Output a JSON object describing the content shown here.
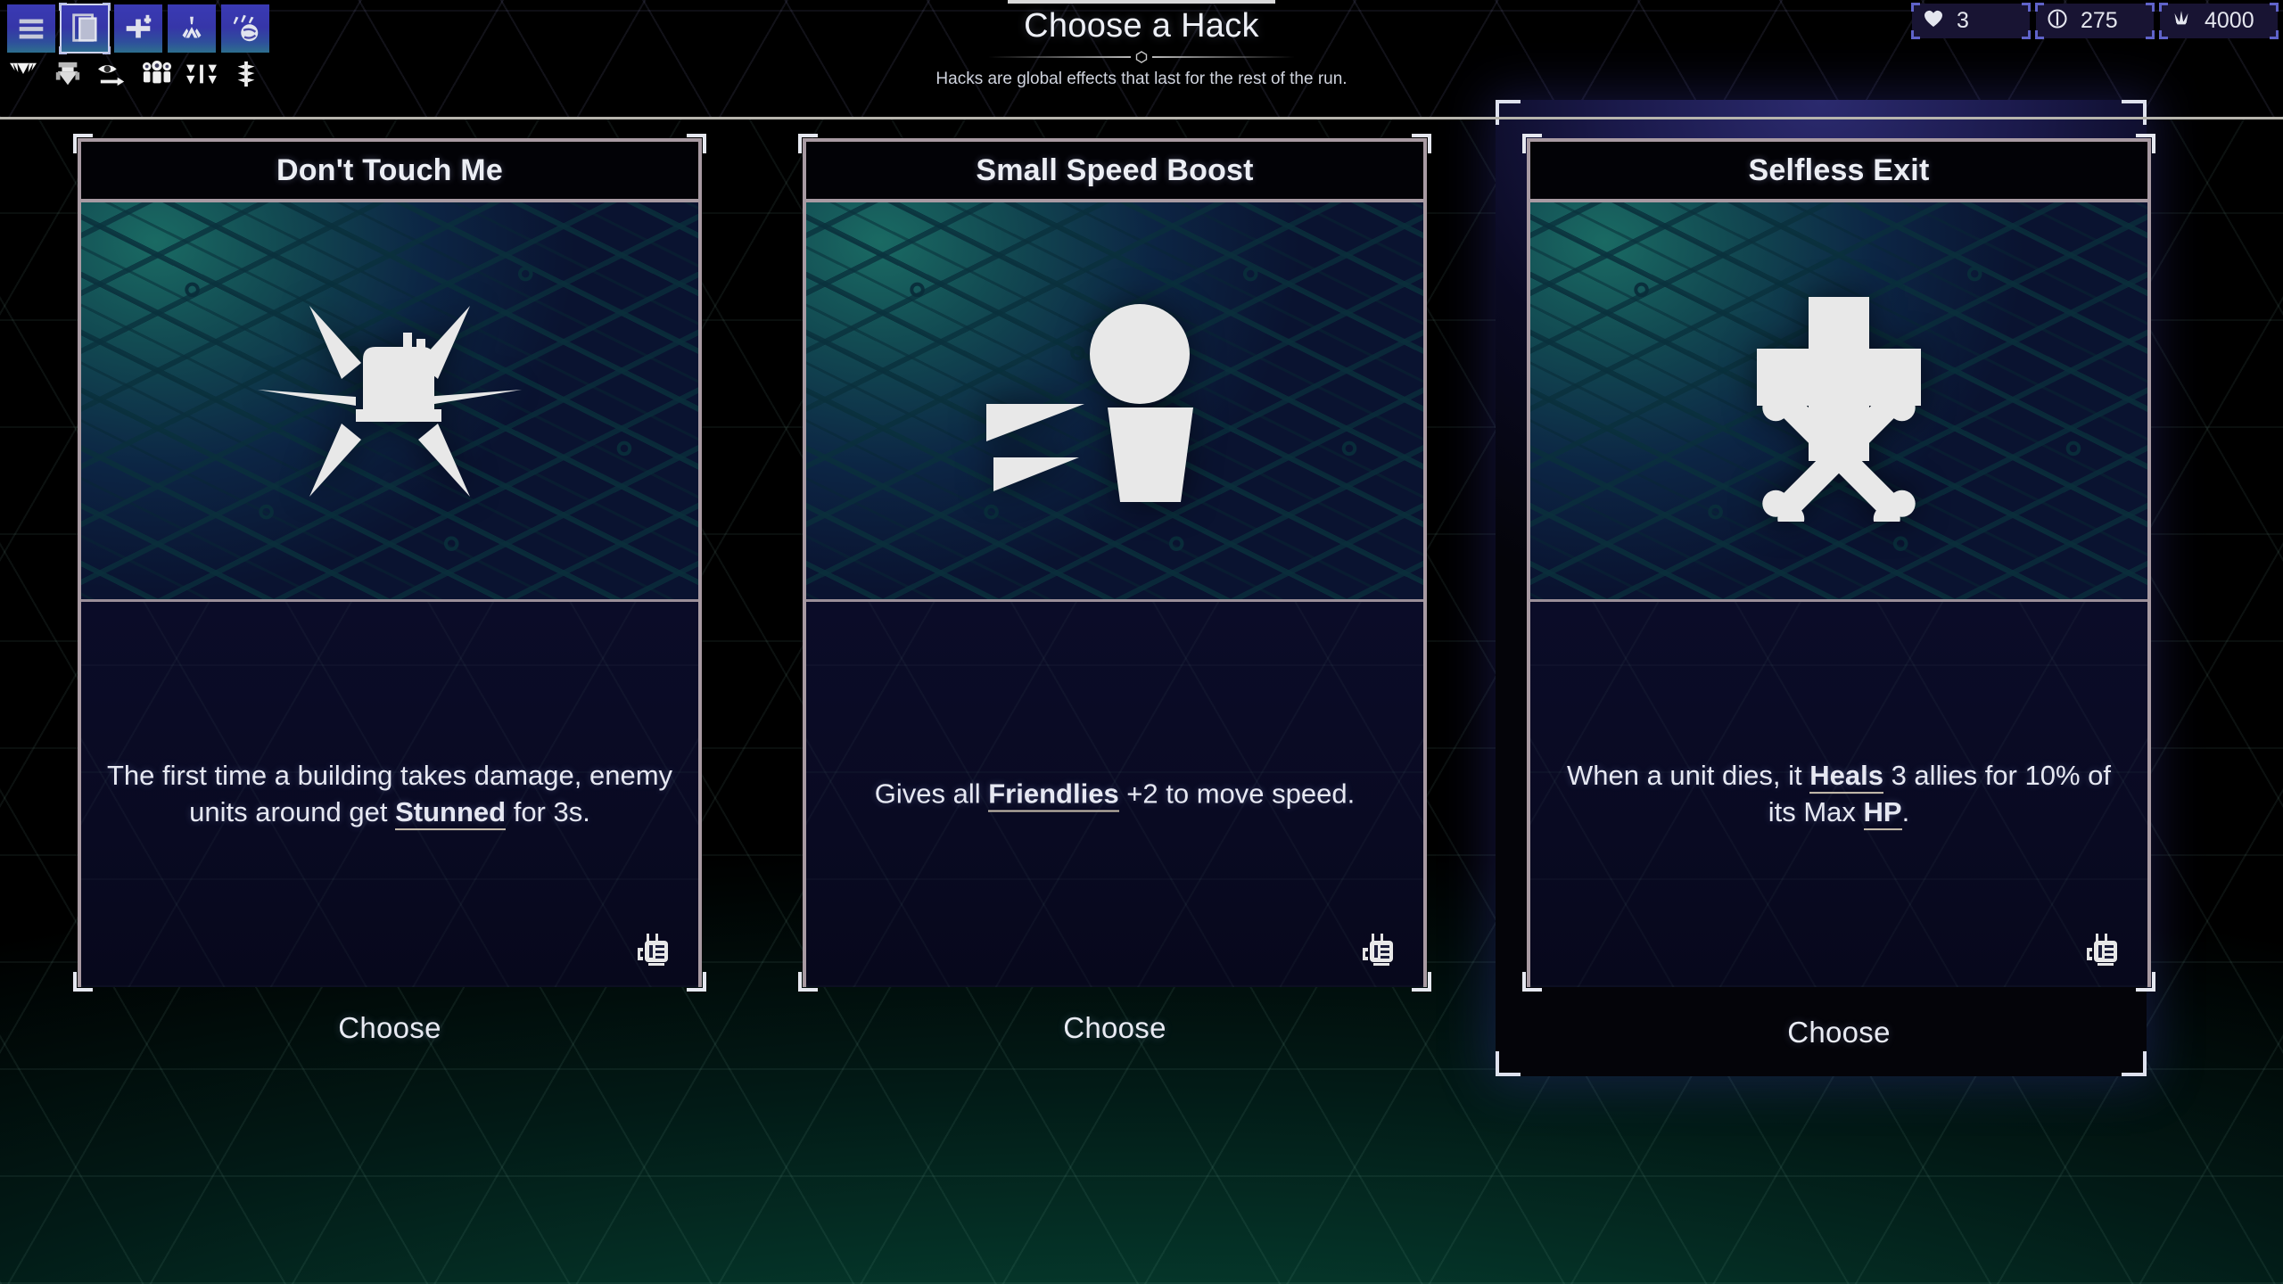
{
  "header": {
    "title": "Choose a Hack",
    "subtitle": "Hacks are global effects that last for the rest of the run.",
    "divider_icon": "hexagon-icon"
  },
  "toolbar": {
    "primary": [
      {
        "name": "menu-button",
        "icon": "hamburger-menu-icon",
        "selected": false
      },
      {
        "name": "cards-button",
        "icon": "stacked-cards-icon",
        "selected": true
      },
      {
        "name": "build-button",
        "icon": "building-plus-icon",
        "selected": false
      },
      {
        "name": "spawn-button",
        "icon": "spawn-burst-icon",
        "selected": false
      },
      {
        "name": "world-button",
        "icon": "meteor-planet-icon",
        "selected": false
      }
    ],
    "secondary": [
      {
        "name": "enemy-button",
        "icon": "enemy-claw-icon"
      },
      {
        "name": "unit-button",
        "icon": "armored-unit-icon"
      },
      {
        "name": "vision-button",
        "icon": "eye-arrow-icon"
      },
      {
        "name": "squad-button",
        "icon": "three-troops-icon"
      },
      {
        "name": "formation-button",
        "icon": "wing-formation-icon"
      },
      {
        "name": "tower-button",
        "icon": "spiked-tower-icon"
      }
    ]
  },
  "resources": [
    {
      "name": "lives-counter",
      "icon": "heart-icon",
      "value": "3"
    },
    {
      "name": "energy-counter",
      "icon": "circle-bar-icon",
      "value": "275"
    },
    {
      "name": "credits-counter",
      "icon": "crown-spikes-icon",
      "value": "4000"
    }
  ],
  "cards": [
    {
      "title": "Don't Touch Me",
      "art_icon": "building-stun-burst-icon",
      "chip_icon": "hack-transmitter-icon",
      "choose_label": "Choose",
      "selected": false,
      "description": [
        {
          "text": "The first time a building takes damage, enemy units around get ",
          "bold": false
        },
        {
          "text": "Stunned",
          "bold": true
        },
        {
          "text": " for 3s.",
          "bold": false
        }
      ]
    },
    {
      "title": "Small Speed Boost",
      "art_icon": "running-figure-speed-icon",
      "chip_icon": "hack-transmitter-icon",
      "choose_label": "Choose",
      "selected": false,
      "description": [
        {
          "text": "Gives all ",
          "bold": false
        },
        {
          "text": "Friendlies",
          "bold": true
        },
        {
          "text": " +2 to move speed.",
          "bold": false
        }
      ]
    },
    {
      "title": "Selfless Exit",
      "art_icon": "cross-and-bones-icon",
      "chip_icon": "hack-transmitter-icon",
      "choose_label": "Choose",
      "selected": true,
      "description": [
        {
          "text": "When a unit dies, it ",
          "bold": false
        },
        {
          "text": "Heals",
          "bold": true
        },
        {
          "text": " 3 allies for 10% of its Max ",
          "bold": false
        },
        {
          "text": "HP",
          "bold": true
        },
        {
          "text": ".",
          "bold": false
        }
      ]
    }
  ],
  "colors": {
    "frame_border": "#a89aa2",
    "bracket": "#e6e8f0",
    "text_primary": "#e9ebf3",
    "accent_purple": "#3a3ab4",
    "resource_bracket": "#5f63c9",
    "background_green": "#0c6e52",
    "keyword_underline": "#c9bfae"
  }
}
